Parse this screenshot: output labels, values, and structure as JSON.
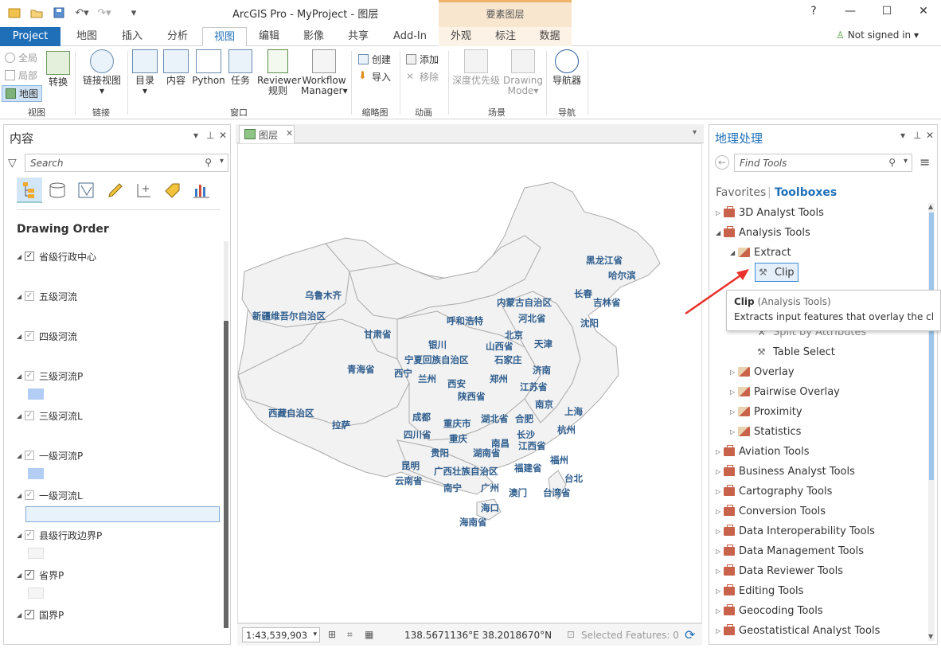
{
  "app": {
    "title": "ArcGIS Pro - MyProject - 图层",
    "context_title": "要素图层"
  },
  "window": {
    "help": "?",
    "minimize": "—",
    "maximize": "☐",
    "close": "✕"
  },
  "tabs": [
    "Project",
    "地图",
    "插入",
    "分析",
    "视图",
    "编辑",
    "影像",
    "共享",
    "Add-In",
    "外观",
    "标注",
    "数据"
  ],
  "account": {
    "status": "Not signed in"
  },
  "ribbon": {
    "view_group": {
      "full": "全局",
      "local": "局部",
      "map": "地图",
      "switch": "转换",
      "label": "视图"
    },
    "link_group": {
      "link_views": "链接视图",
      "label": "链接"
    },
    "window_group": {
      "catalog": "目录",
      "contents": "内容",
      "python": "Python",
      "tasks": "任务",
      "reviewer": "Reviewer 规则",
      "reviewer_l1": "Reviewer",
      "reviewer_l2": "规则",
      "workflow_l1": "Workflow",
      "workflow_l2": "Manager",
      "label": "窗口"
    },
    "thumb_group": {
      "create": "创建",
      "import": "导入",
      "label": "缩略图"
    },
    "anim_group": {
      "add": "添加",
      "remove": "移除",
      "label": "动画"
    },
    "scene_group": {
      "depth": "深度优先级",
      "drawing_l1": "Drawing",
      "drawing_l2": "Mode",
      "label": "场景"
    },
    "nav_group": {
      "navigator": "导航器",
      "label": "导航"
    }
  },
  "contents": {
    "title": "内容",
    "search_placeholder": "Search",
    "drawing_order": "Drawing Order",
    "layers": [
      {
        "name": "省级行政中心",
        "checked": true
      },
      {
        "name": "五级河流",
        "checked": true
      },
      {
        "name": "四级河流",
        "checked": true
      },
      {
        "name": "三级河流P",
        "checked": true
      },
      {
        "name": "三级河流L",
        "checked": true
      },
      {
        "name": "一级河流P",
        "checked": true
      },
      {
        "name": "一级河流L",
        "checked": true
      },
      {
        "name": "县级行政边界P",
        "checked": true
      },
      {
        "name": "省界P",
        "checked": true
      },
      {
        "name": "国界P",
        "checked": true
      }
    ]
  },
  "map": {
    "tab": "图层",
    "scale": "1:43,539,903",
    "coordinates": "138.5671136°E 38.2018670°N",
    "selected": "Selected Features: 0",
    "labels": [
      "黑龙江省",
      "哈尔滨",
      "长春",
      "吉林省",
      "沈阳",
      "内蒙古自治区",
      "乌鲁木齐",
      "新疆维吾尔自治区",
      "呼和浩特",
      "河北省",
      "北京",
      "天津",
      "甘肃省",
      "银川",
      "宁夏回族自治区",
      "山西省",
      "石家庄",
      "青海省",
      "西宁",
      "兰州",
      "济南",
      "西安",
      "郑州",
      "江苏省",
      "陕西省",
      "南京",
      "上海",
      "西藏自治区",
      "成都",
      "重庆市",
      "湖北省",
      "合肥",
      "拉萨",
      "四川省",
      "重庆",
      "长沙",
      "南昌",
      "杭州",
      "江西省",
      "贵阳",
      "湖南省",
      "昆明",
      "福州",
      "广西壮族自治区",
      "福建省",
      "云南省",
      "南宁",
      "广州",
      "台北",
      "澳门",
      "台湾省",
      "海口",
      "海南省"
    ]
  },
  "geoprocessing": {
    "title": "地理处理",
    "search_placeholder": "Find Tools",
    "favorites": "Favorites",
    "toolboxes": "Toolboxes",
    "tree": {
      "analyst3d": "3D Analyst Tools",
      "analysis": "Analysis Tools",
      "extract": "Extract",
      "clip": "Clip",
      "split_by_attributes": "Split by Attributes",
      "table_select": "Table Select",
      "overlay": "Overlay",
      "pairwise": "Pairwise Overlay",
      "proximity": "Proximity",
      "statistics": "Statistics",
      "aviation": "Aviation Tools",
      "business": "Business Analyst Tools",
      "cartography": "Cartography Tools",
      "conversion": "Conversion Tools",
      "interop": "Data Interoperability Tools",
      "management": "Data Management Tools",
      "reviewer": "Data Reviewer Tools",
      "editing": "Editing Tools",
      "geocoding": "Geocoding Tools",
      "geostat": "Geostatistical Analyst Tools"
    },
    "tooltip": {
      "name": "Clip",
      "source": "(Analysis Tools)",
      "description": "Extracts input features that overlay the clip fe"
    }
  },
  "colors": {
    "accent": "#1f6fb8",
    "context_tab": "#f9e6cf",
    "river_swatch": "#b3cdf5",
    "annotation_arrow": "#e8322b"
  }
}
